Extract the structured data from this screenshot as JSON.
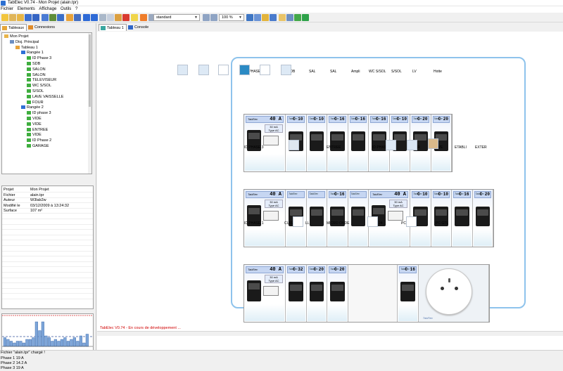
{
  "window": {
    "title": "TabElec V0.74 - Mon Projet (alain.tpr)"
  },
  "menu": [
    "Fichier",
    "Elements",
    "Affichage",
    "Outils",
    "?"
  ],
  "toolbar": {
    "style_select": "standard",
    "zoom_select": "100 %"
  },
  "left_tabs": [
    "Tableaux",
    "Connexions"
  ],
  "tree": [
    {
      "label": "Mon Projet",
      "level": 0,
      "icon": "project-icon"
    },
    {
      "label": "Disj. Principal",
      "level": 1,
      "icon": "main-breaker-icon"
    },
    {
      "label": "Tableau 1",
      "level": 2,
      "icon": "panel-icon"
    },
    {
      "label": "Rangée 1",
      "level": 3,
      "icon": "row-icon"
    },
    {
      "label": "ID Phase 3",
      "level": 4,
      "icon": "breaker-icon"
    },
    {
      "label": "SDB",
      "level": 4,
      "icon": "breaker-icon"
    },
    {
      "label": "SALON",
      "level": 4,
      "icon": "breaker-icon"
    },
    {
      "label": "SALON",
      "level": 4,
      "icon": "breaker-icon"
    },
    {
      "label": "TELEVISEUR",
      "level": 4,
      "icon": "breaker-icon"
    },
    {
      "label": "WC S/SOL",
      "level": 4,
      "icon": "breaker-icon"
    },
    {
      "label": "S/SOL",
      "level": 4,
      "icon": "breaker-icon"
    },
    {
      "label": "LAVE VAISSELLE",
      "level": 4,
      "icon": "breaker-icon"
    },
    {
      "label": "FOUR",
      "level": 4,
      "icon": "breaker-icon"
    },
    {
      "label": "Rangée 2",
      "level": 3,
      "icon": "row-icon"
    },
    {
      "label": "ID phase 3",
      "level": 4,
      "icon": "breaker-icon"
    },
    {
      "label": "VIDE",
      "level": 4,
      "icon": "breaker-icon"
    },
    {
      "label": "VIDE",
      "level": 4,
      "icon": "breaker-icon"
    },
    {
      "label": "ENTREE",
      "level": 4,
      "icon": "breaker-icon"
    },
    {
      "label": "VIDE",
      "level": 4,
      "icon": "breaker-icon"
    },
    {
      "label": "ID Phase 2",
      "level": 4,
      "icon": "breaker-icon"
    },
    {
      "label": "GARAGE",
      "level": 4,
      "icon": "breaker-icon"
    }
  ],
  "properties": [
    {
      "key": "Projet",
      "value": "Mon Projet"
    },
    {
      "key": "Fichier",
      "value": "alain.tpr"
    },
    {
      "key": "Auteur",
      "value": "W3lab2w"
    },
    {
      "key": "Modifié le",
      "value": "03/12/2009 à 13:24:32"
    },
    {
      "key": "Surface",
      "value": "107 m²"
    }
  ],
  "phase_hist": {
    "values": [
      5,
      4,
      3,
      2,
      3,
      3,
      2,
      4,
      4,
      5,
      14,
      9,
      14,
      6,
      5,
      3,
      4,
      3,
      4,
      5,
      3,
      4,
      5,
      3,
      6,
      2,
      7
    ]
  },
  "phases": [
    "Phase 1 19 A",
    "Phase 2 14.2 A",
    "Phase 3 19 A"
  ],
  "right_tabs": [
    "Tableau 1",
    "Console"
  ],
  "rows": [
    {
      "labels": [
        "ID PHASE 3",
        "SDB",
        "SAL",
        "SAL",
        "Ampli",
        "WC S/SOL",
        "S/SOL",
        "LV",
        "Hotte"
      ],
      "modules": [
        {
          "kind": "diff",
          "cal": "40 A",
          "ma": "30 mA",
          "type": "Type AC"
        },
        {
          "kind": "brk",
          "cal": "C 10"
        },
        {
          "kind": "brk",
          "cal": "C 10"
        },
        {
          "kind": "brk",
          "cal": "C 16"
        },
        {
          "kind": "brk",
          "cal": "C 16"
        },
        {
          "kind": "brk",
          "cal": "C 16"
        },
        {
          "kind": "brk",
          "cal": "C 10"
        },
        {
          "kind": "brk",
          "cal": "C 20"
        },
        {
          "kind": "brk",
          "cal": "C 20"
        }
      ]
    },
    {
      "labels": [
        "ID PHASE 3",
        "ENTREE",
        "ID PHASE 2",
        "GAR",
        "CAVE",
        "ETABLI",
        "EXTER"
      ],
      "modules": [
        {
          "kind": "diff",
          "cal": "40 A",
          "ma": "30 mA",
          "type": "Type AC"
        },
        {
          "kind": "brk",
          "cal": ""
        },
        {
          "kind": "brk",
          "cal": ""
        },
        {
          "kind": "brk",
          "cal": "C 16"
        },
        {
          "kind": "brk",
          "cal": ""
        },
        {
          "kind": "diff",
          "cal": "40 A",
          "ma": "30 mA",
          "type": "Type AC"
        },
        {
          "kind": "brk",
          "cal": "C 10"
        },
        {
          "kind": "brk",
          "cal": "C 10"
        },
        {
          "kind": "brk",
          "cal": "C 16"
        },
        {
          "kind": "brk",
          "cal": "C 20"
        }
      ]
    },
    {
      "labels": [
        "ID PHASE 1",
        "CUISSON",
        "LL",
        "MICRO ONDE",
        "MOD 24",
        "PC GTL",
        "PC GTL"
      ],
      "modules": [
        {
          "kind": "diff",
          "cal": "40 A",
          "ma": "30 mA",
          "type": "Type AC"
        },
        {
          "kind": "brk",
          "cal": "C 32"
        },
        {
          "kind": "brk",
          "cal": "C 20"
        },
        {
          "kind": "brk",
          "cal": "C 20"
        },
        {
          "kind": "blank"
        },
        {
          "kind": "brk",
          "cal": "C 16"
        },
        {
          "kind": "socket"
        }
      ]
    }
  ],
  "socket_brand": "TabElec",
  "dev_notice": "TabElec V0.74 - En cours de développement ...",
  "status": "Fichier \"alain.tpr\" chargé !"
}
